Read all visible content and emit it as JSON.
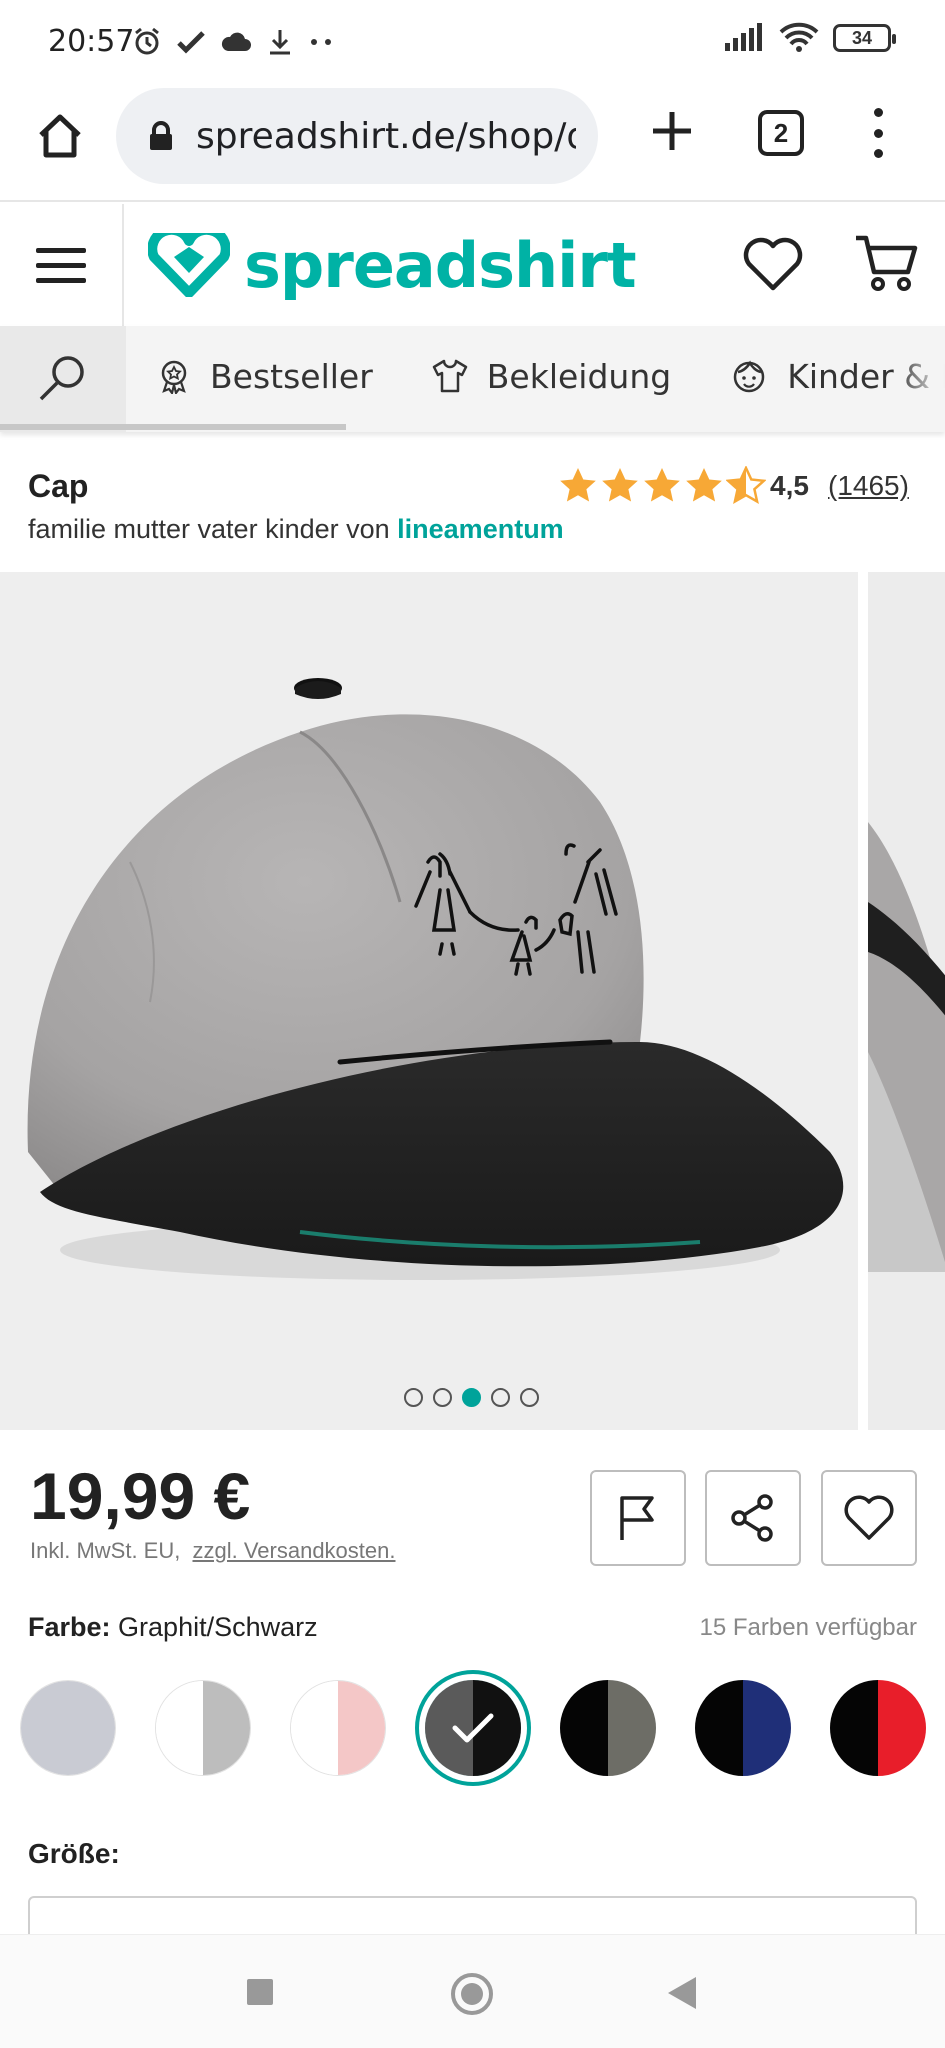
{
  "status_bar": {
    "time": "20:57",
    "battery": "34",
    "icons": [
      "alarm-icon",
      "check-icon",
      "cloud-icon",
      "download-icon",
      "more-dots-icon",
      "signal-icon",
      "wifi-icon",
      "battery-icon"
    ]
  },
  "browser": {
    "url": "spreadshirt.de/shop/d",
    "tab_count": "2"
  },
  "header": {
    "logo_text": "spreadshirt",
    "brand_color": "#00b2a5"
  },
  "categories": {
    "items": [
      {
        "label": "Bestseller",
        "icon": "badge-icon"
      },
      {
        "label": "Bekleidung",
        "icon": "tshirt-icon"
      },
      {
        "label": "Kinder & Babys",
        "icon": "child-face-icon"
      }
    ]
  },
  "product": {
    "title": "Cap",
    "subtitle_prefix": "familie mutter vater kinder von",
    "designer": "lineamentum",
    "rating_value": "4,5",
    "rating_count": "(1465)",
    "stars": 4.5,
    "carousel": {
      "slide_count": 5,
      "active_index": 2
    },
    "price": "19,99 €",
    "price_note_tax": "Inkl. MwSt. EU,",
    "price_note_shipping": "zzgl. Versandkosten.",
    "color_label": "Farbe:",
    "color_value": "Graphit/Schwarz",
    "color_count": "15 Farben verfügbar",
    "swatches": [
      {
        "left": "#c9cbd3",
        "right": "#c9cbd3",
        "selected": false
      },
      {
        "left": "#ffffff",
        "right": "#bdbdbd",
        "selected": false
      },
      {
        "left": "#ffffff",
        "right": "#f4c7c7",
        "selected": false
      },
      {
        "left": "#5a5a5a",
        "right": "#111111",
        "selected": true
      },
      {
        "left": "#050505",
        "right": "#6d6d66",
        "selected": false
      },
      {
        "left": "#050505",
        "right": "#1f2f78",
        "selected": false
      },
      {
        "left": "#050505",
        "right": "#e81e2a",
        "selected": false
      }
    ],
    "size_label": "Größe:"
  }
}
